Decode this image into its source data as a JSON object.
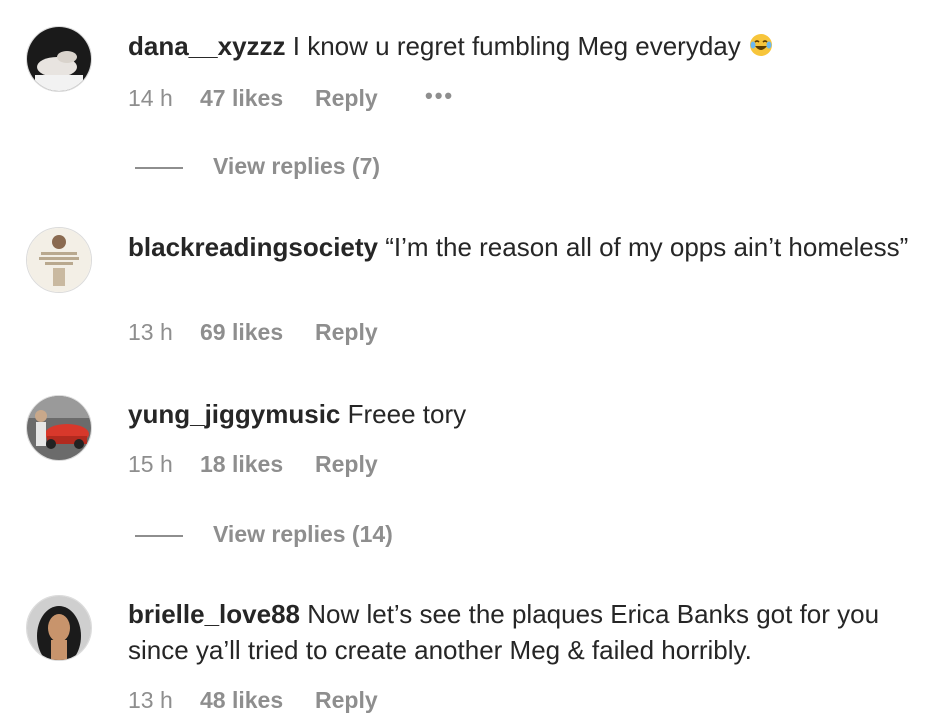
{
  "comments": [
    {
      "username": "dana__xyzzz",
      "text": "I know u regret fumbling Meg everyday",
      "emoji": "face-with-tears-of-joy",
      "time": "14 h",
      "likes": "47 likes",
      "reply": "Reply",
      "more": "•••",
      "view_replies": "View replies (7)"
    },
    {
      "username": "blackreadingsociety",
      "text": "“I’m the reason all of my opps ain’t homeless”",
      "time": "13 h",
      "likes": "69 likes",
      "reply": "Reply"
    },
    {
      "username": "yung_jiggymusic",
      "text": "Freee tory",
      "time": "15 h",
      "likes": "18 likes",
      "reply": "Reply",
      "view_replies": "View replies (14)"
    },
    {
      "username": "brielle_love88",
      "text": "Now let’s see the plaques Erica Banks got for you since ya’ll tried to create another Meg & failed horribly.",
      "time": "13 h",
      "likes": "48 likes",
      "reply": "Reply"
    }
  ],
  "colors": {
    "text": "#262626",
    "secondary": "#8e8e8e",
    "border": "#dbdbdb"
  }
}
